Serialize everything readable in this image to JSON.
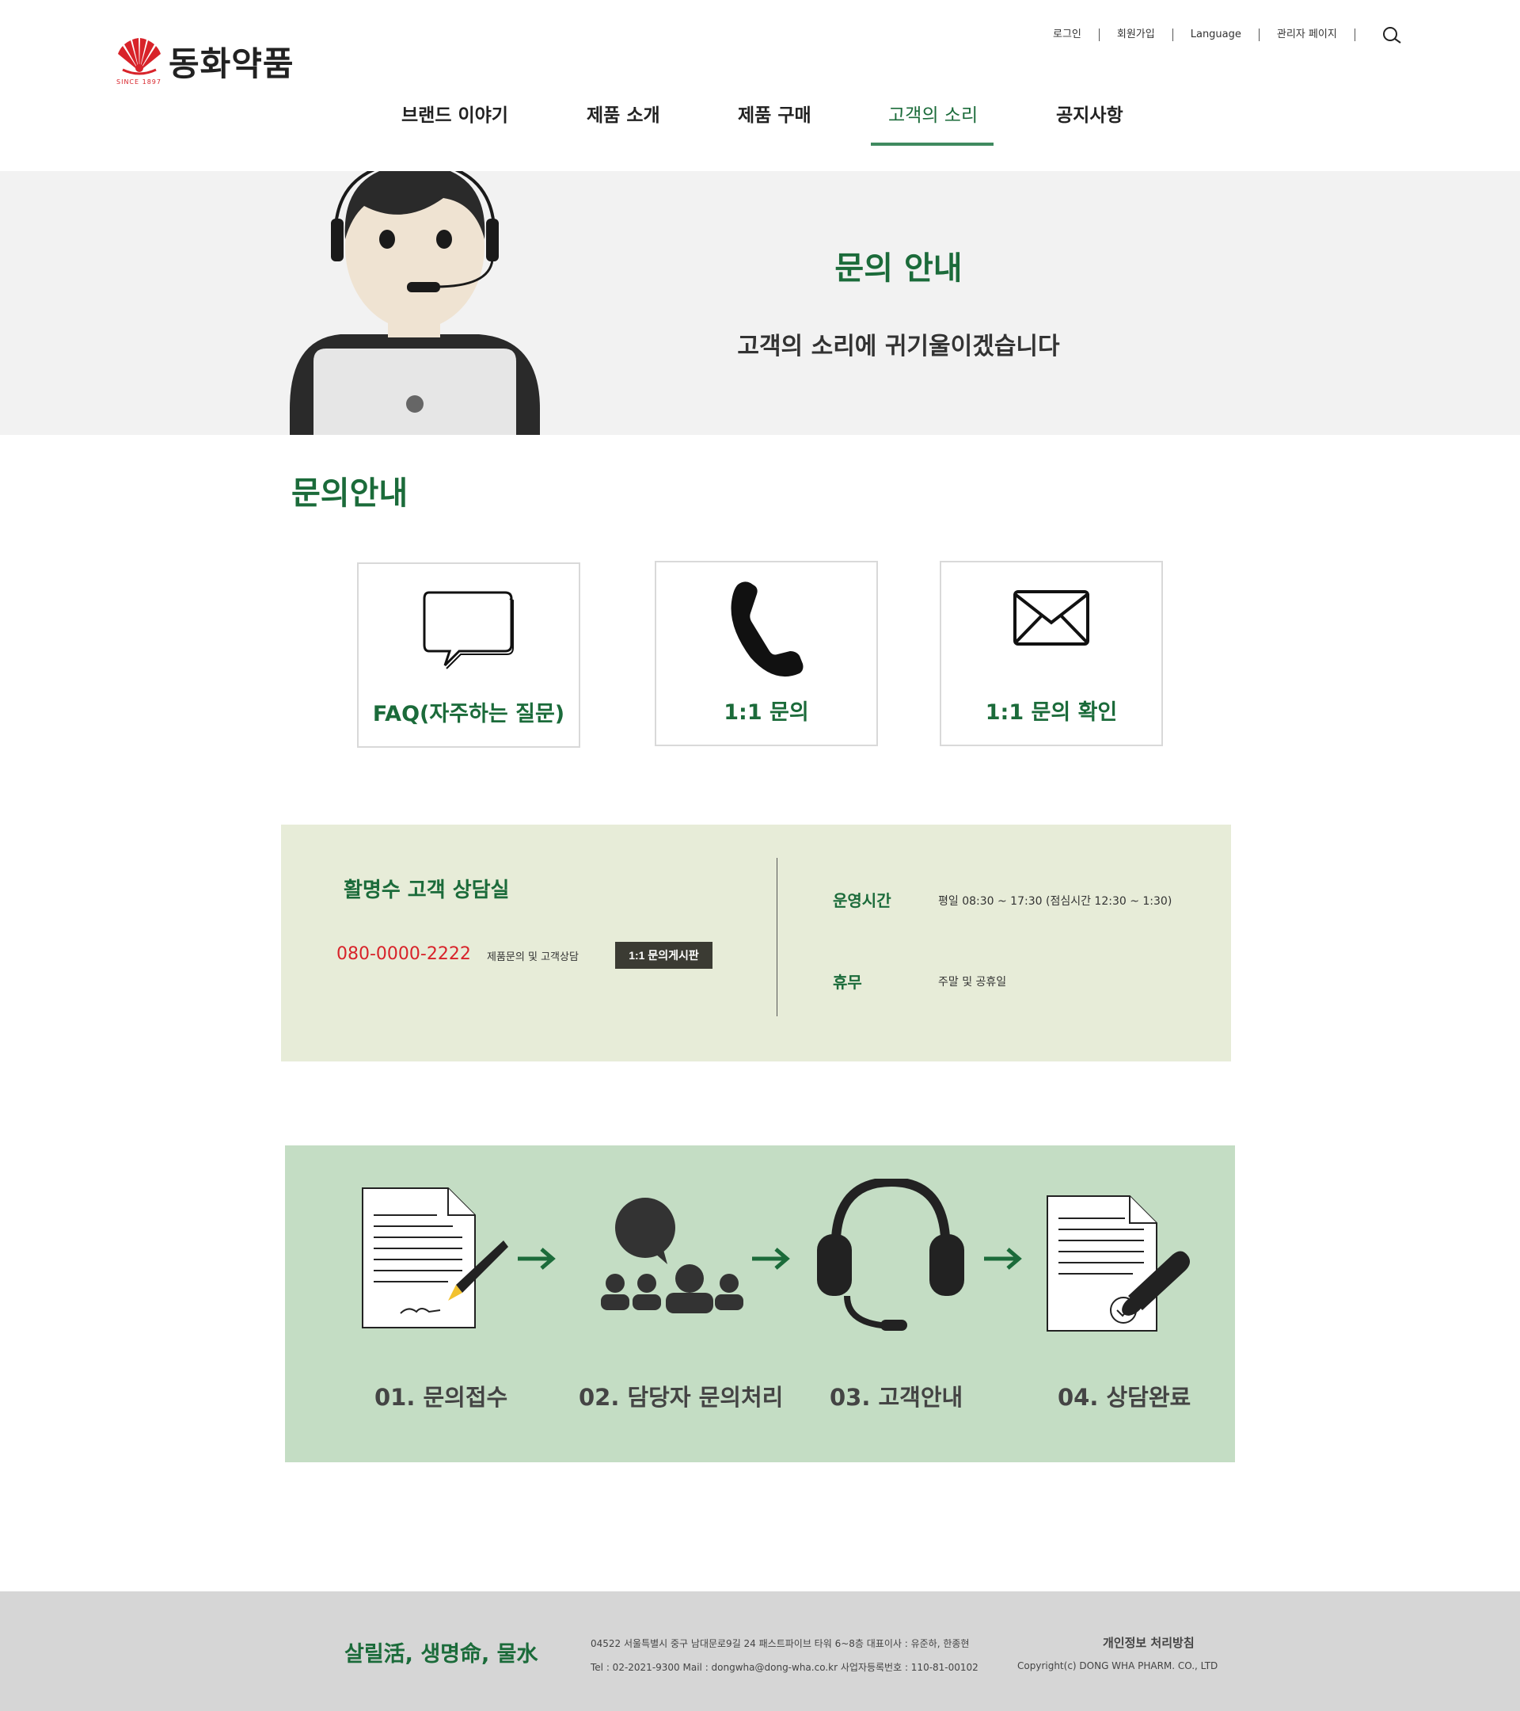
{
  "header": {
    "logo_text": "동화약품",
    "logo_since": "SINCE 1897",
    "util": [
      "로그인",
      "회원가입",
      "Language",
      "관리자 페이지"
    ],
    "nav": [
      "브랜드 이야기",
      "제품 소개",
      "제품 구매",
      "고객의 소리",
      "공지사항"
    ],
    "active_nav": "고객의 소리"
  },
  "hero": {
    "title": "문의 안내",
    "subtitle": "고객의 소리에 귀기울이겠습니다"
  },
  "section_title": "문의안내",
  "cards": [
    {
      "label": "FAQ(자주하는 질문)",
      "icon": "speech-bubble-icon"
    },
    {
      "label": "1:1 문의",
      "icon": "phone-icon"
    },
    {
      "label": "1:1 문의 확인",
      "icon": "envelope-icon"
    }
  ],
  "contact": {
    "title": "활명수 고객 상담실",
    "phone": "080-0000-2222",
    "desc": "제품문의 및 고객상담",
    "button": "1:1 문의게시판",
    "hours_label": "운영시간",
    "hours_value": "평일 08:30 ~ 17:30 (점심시간 12:30 ~ 1:30)",
    "holiday_label": "휴무",
    "holiday_value": "주말 및 공휴일"
  },
  "process": [
    {
      "label": "01. 문의접수",
      "icon": "document-sign-icon"
    },
    {
      "label": "02. 담당자 문의처리",
      "icon": "people-chat-icon"
    },
    {
      "label": "03. 고객안내",
      "icon": "headset-icon"
    },
    {
      "label": "04. 상담완료",
      "icon": "document-stamp-icon"
    }
  ],
  "footer": {
    "slogan": "살릴活, 생명命, 물水",
    "address": "04522 서울특별시 중구 남대문로9길 24 패스트파이브 타워 6~8층 대표이사 : 유준하, 한종현",
    "tel": "Tel : 02-2021-9300  Mail : dongwha@dong-wha.co.kr 사업자등록번호 : 110-81-00102",
    "privacy": "개인정보 처리방침",
    "copyright": "Copyright(c) DONG WHA PHARM. CO., LTD"
  },
  "colors": {
    "brand_green": "#1b6b3a",
    "brand_red": "#d8232a",
    "hero_bg": "#f2f2f2",
    "contact_bg": "#e7ecd8",
    "process_bg": "#c4ddc4",
    "footer_bg": "#d6d6d6"
  }
}
